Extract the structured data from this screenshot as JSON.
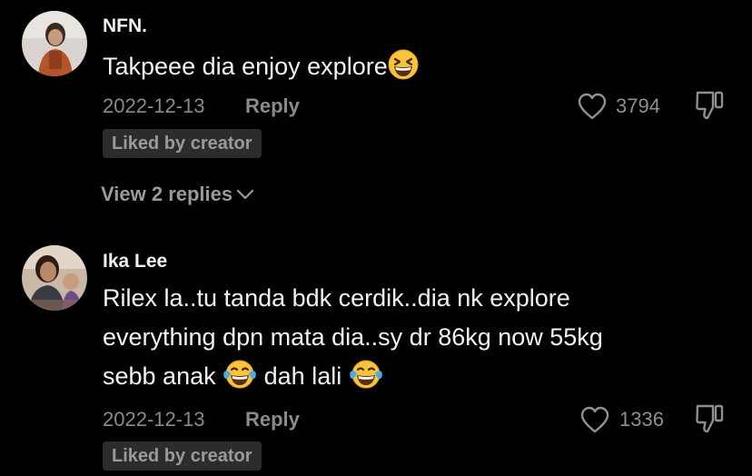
{
  "colors": {
    "background": "#000000",
    "meta_text": "#8a8a8a",
    "badge_bg": "#2c2c2c"
  },
  "comments": [
    {
      "username": "NFN.",
      "text": "Takpeee dia enjoy explore",
      "text_emoji": "grinning-squinting-face-emoji",
      "date": "2022-12-13",
      "reply_label": "Reply",
      "likes": "3794",
      "badge": "Liked by creator",
      "view_replies": "View 2 replies",
      "icons": [
        "heart-outline-icon",
        "thumbs-down-icon",
        "chevron-down-icon"
      ]
    },
    {
      "username": "Ika Lee",
      "text_line1": "Rilex la..tu tanda bdk cerdik..dia nk explore",
      "text_line2": "everything dpn mata dia..sy dr 86kg now 55kg",
      "text_line3a": "sebb anak",
      "text_line3b": "dah lali",
      "text_emoji": "face-with-tears-of-joy-emoji",
      "date": "2022-12-13",
      "reply_label": "Reply",
      "likes": "1336",
      "badge": "Liked by creator",
      "icons": [
        "heart-outline-icon",
        "thumbs-down-icon"
      ]
    }
  ]
}
